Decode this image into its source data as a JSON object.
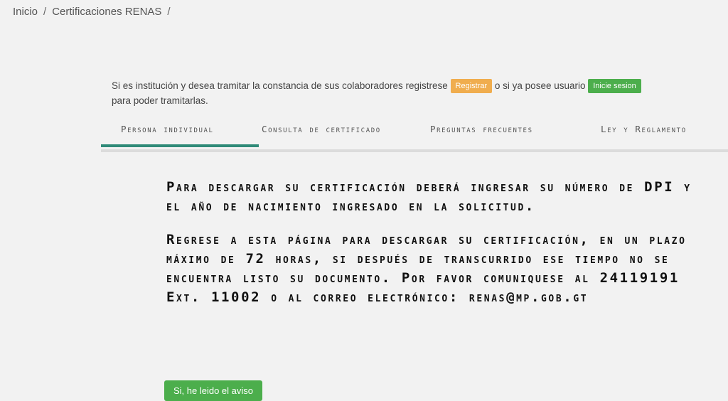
{
  "breadcrumb": {
    "items": [
      "Inicio",
      "Certificaciones RENAS"
    ],
    "separator": "/"
  },
  "intro": {
    "text_before": "Si es institución y desea tramitar la constancia de sus colaboradores registrese",
    "register_label": "Registrar",
    "text_middle": "o si ya posee usuario",
    "login_label": "Inicie sesion",
    "text_after": "para poder tramitarlas."
  },
  "tabs": [
    {
      "label": "Persona individual",
      "active": true
    },
    {
      "label": "Consulta de certificado",
      "active": false
    },
    {
      "label": "Preguntas frecuentes",
      "active": false
    },
    {
      "label": "Ley y Reglamento",
      "active": false
    }
  ],
  "notice": {
    "paragraph1": "Para descargar su certificación deberá ingresar su número de DPI y el año de nacimiento ingresado en la solicitud.",
    "paragraph2": "Regrese a esta página para descargar su certificación, en un plazo máximo de 72 horas, si después de transcurrido ese tiempo no se encuentra listo su documento. Por favor comuniquese al 24119191 Ext. 11002 o al correo electrónico: renas@mp.gob.gt"
  },
  "ack_button_label": "Si, he leido el aviso",
  "colors": {
    "accent_teal": "#2f8a78",
    "button_green": "#4cae4c",
    "button_orange": "#f0ad4e"
  }
}
